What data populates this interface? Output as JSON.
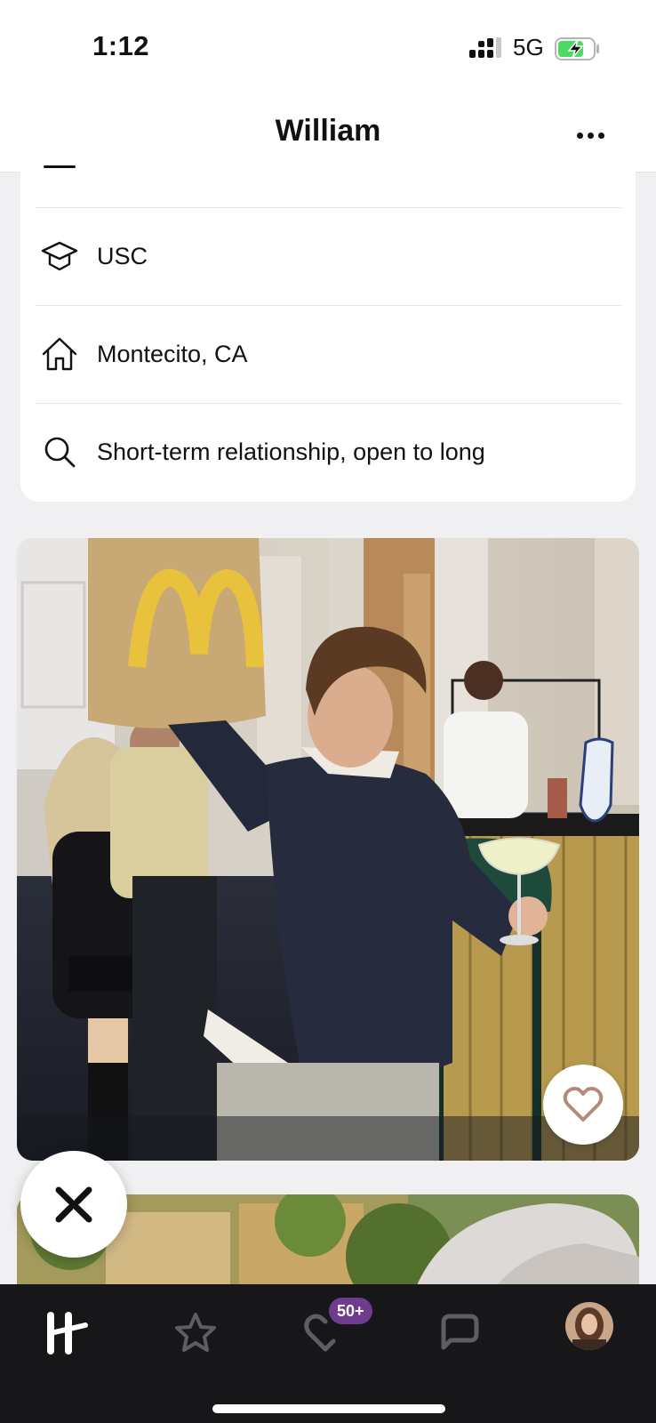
{
  "status_bar": {
    "time": "1:12",
    "network": "5G",
    "battery_charging": true
  },
  "header": {
    "title": "William",
    "more_icon": "ellipsis-icon"
  },
  "info_rows": [
    {
      "icon": "graduation-cap-icon",
      "text": "USC"
    },
    {
      "icon": "home-icon",
      "text": "Montecito, CA"
    },
    {
      "icon": "search-icon",
      "text": "Short-term relationship, open to long"
    }
  ],
  "photo": {
    "like_icon": "heart-icon"
  },
  "actions": {
    "skip_icon": "skip-x-icon"
  },
  "tab_bar": {
    "tabs": [
      {
        "name": "discover",
        "icon": "hinge-logo-icon"
      },
      {
        "name": "standouts",
        "icon": "star-icon"
      },
      {
        "name": "likes-you",
        "icon": "heart-icon",
        "badge": "50+"
      },
      {
        "name": "matches",
        "icon": "chat-bubble-icon"
      },
      {
        "name": "profile",
        "icon": "avatar"
      }
    ]
  },
  "colors": {
    "badge": "#6e3b8e",
    "tab_bar_bg": "#17171a",
    "page_bg": "#f0f0f2",
    "battery_green": "#4cd964"
  }
}
